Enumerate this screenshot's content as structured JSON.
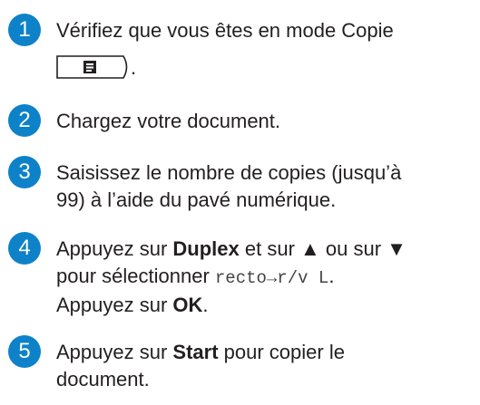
{
  "steps": [
    {
      "number": "1",
      "line1": "Vérifiez que vous êtes en mode Copie",
      "after_icon": ".",
      "icon": "copy-mode-key-icon"
    },
    {
      "number": "2",
      "line1": "Chargez votre document."
    },
    {
      "number": "3",
      "line1": "Saisissez le nombre de copies (jusqu’à",
      "line2": "99) à l’aide du pavé numérique."
    },
    {
      "number": "4",
      "l1_pre": "Appuyez sur ",
      "l1_bold": "Duplex",
      "l1_post": " et sur ▲ ou sur ▼",
      "l2_pre": "pour sélectionner ",
      "l2_mono": "recto→r/v L",
      "l2_post": ".",
      "l3_pre": "Appuyez sur ",
      "l3_bold": "OK",
      "l3_post": "."
    },
    {
      "number": "5",
      "l1_pre": "Appuyez sur ",
      "l1_bold": "Start",
      "l1_post": " pour copier le",
      "line2": "document."
    }
  ],
  "colors": {
    "step_badge": "#0e82c8",
    "text": "#231f20"
  }
}
